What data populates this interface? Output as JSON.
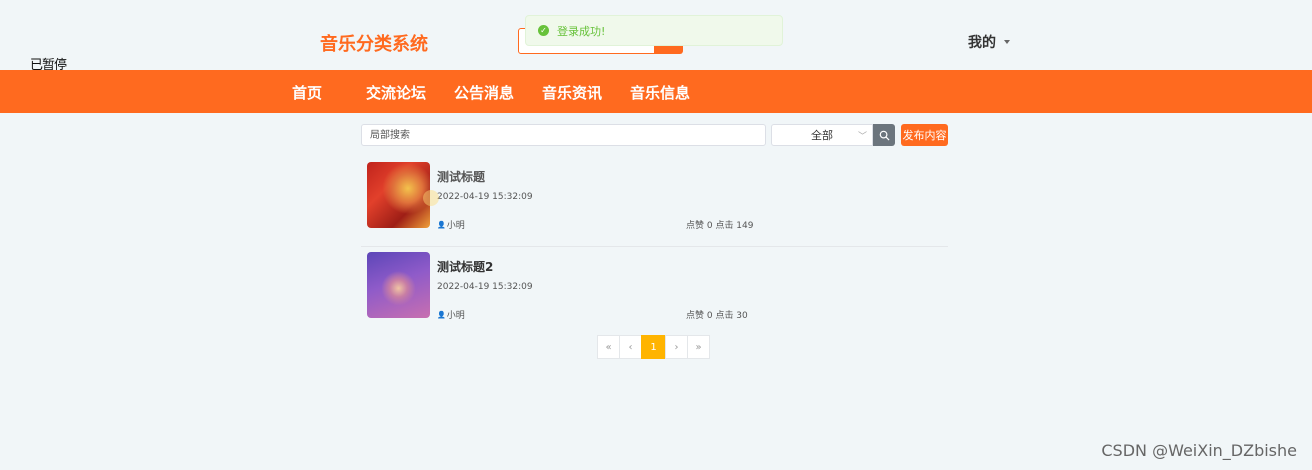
{
  "status": {
    "paused_label": "已暂停"
  },
  "header": {
    "site_title": "音乐分类系统",
    "user_menu_label": "我的"
  },
  "toast": {
    "message": "登录成功!"
  },
  "nav": {
    "items": [
      "首页",
      "交流论坛",
      "公告消息",
      "音乐资讯",
      "音乐信息"
    ]
  },
  "toolbar": {
    "search_placeholder": "局部搜索",
    "category_selected": "全部",
    "publish_label": "发布内容"
  },
  "posts": [
    {
      "title": "测试标题",
      "date": "2022-04-19 15:32:09",
      "author": "小明",
      "stats": "点赞 0 点击 149"
    },
    {
      "title": "测试标题2",
      "date": "2022-04-19 15:32:09",
      "author": "小明",
      "stats": "点赞 0 点击 30"
    }
  ],
  "pagination": {
    "first": "«",
    "prev": "‹",
    "current": "1",
    "next": "›",
    "last": "»"
  },
  "watermark": "CSDN @WeiXin_DZbishe",
  "colors": {
    "brand": "#ff6a1f",
    "success": "#67c23a",
    "active_page": "#ffb400"
  }
}
